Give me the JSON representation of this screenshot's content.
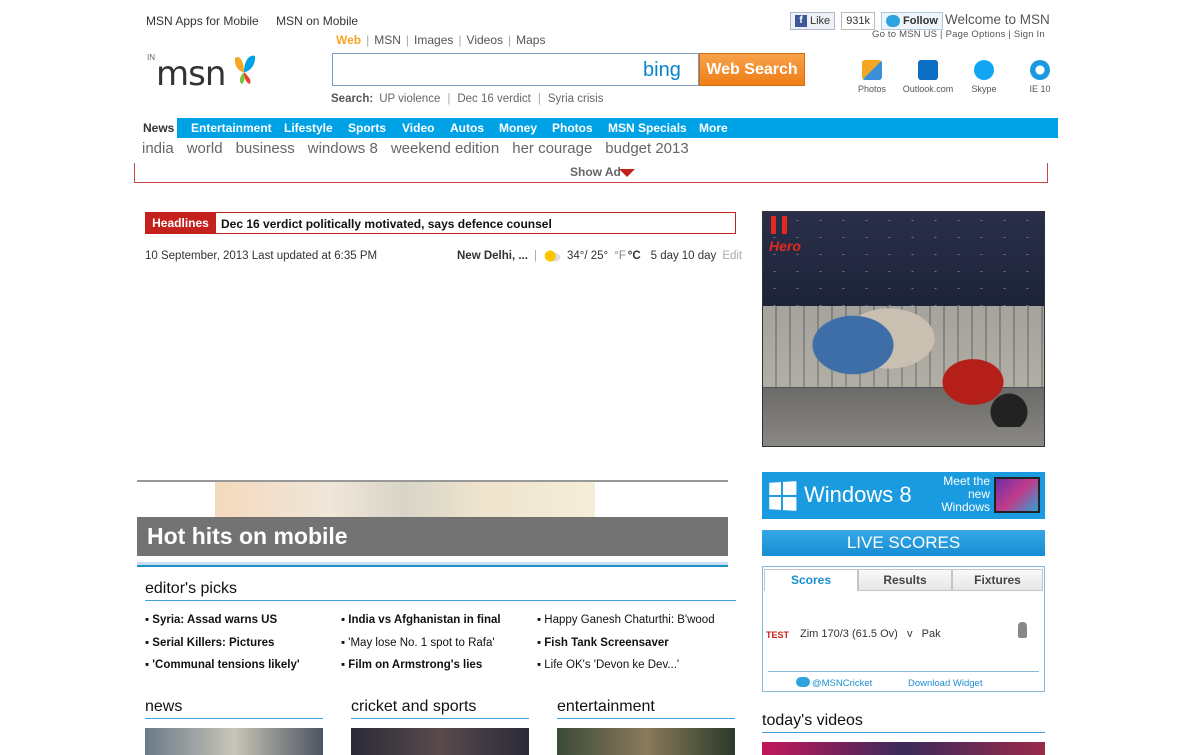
{
  "top_links": [
    "MSN Apps for Mobile",
    "MSN on Mobile"
  ],
  "social": {
    "like": "Like",
    "like_count": "931k",
    "follow": "Follow"
  },
  "welcome": "Welcome to MSN",
  "user_links": "Go to MSN US | Page Options | Sign In",
  "logo": {
    "region": "IN",
    "text": "msn"
  },
  "search": {
    "tabs": [
      "Web",
      "MSN",
      "Images",
      "Videos",
      "Maps"
    ],
    "active_tab": "Web",
    "bing": "bing",
    "button": "Web Search",
    "trending_label": "Search:",
    "trending": [
      "UP violence",
      "Dec 16 verdict",
      "Syria crisis"
    ]
  },
  "apps": [
    {
      "label": "Photos",
      "color": "#3a8fd6"
    },
    {
      "label": "Outlook.com",
      "color": "#0a6fc2"
    },
    {
      "label": "Skype",
      "color": "#12a5f4"
    },
    {
      "label": "IE 10",
      "color": "#1a9be0"
    }
  ],
  "nav": {
    "active": "News",
    "items": [
      "Entertainment",
      "Lifestyle",
      "Sports",
      "Video",
      "Autos",
      "Money",
      "Photos",
      "MSN Specials",
      "More"
    ]
  },
  "sublinks": [
    "india",
    "world",
    "business",
    "windows 8",
    "weekend edition",
    "her courage",
    "budget 2013"
  ],
  "show_ad": "Show Ad",
  "headline": {
    "label": "Headlines",
    "text": "Dec 16 verdict politically motivated, says defence counsel"
  },
  "dateline": "10 September, 2013  Last updated at 6:35 PM",
  "weather": {
    "city": "New Delhi, ...",
    "temps": "34°/ 25°",
    "unit_f": "°F",
    "unit_c": "°C",
    "forecast5": "5 day",
    "forecast10": "10 day",
    "edit": "Edit"
  },
  "hot_hits": "Hot hits on mobile",
  "editors_picks": {
    "title": "editor's picks",
    "items": [
      {
        "text": "Syria: Assad warns US",
        "bold": true
      },
      {
        "text": "India vs Afghanistan in final",
        "bold": true
      },
      {
        "text": "Happy Ganesh Chaturthi: B'wood",
        "bold": false
      },
      {
        "text": "Serial Killers: Pictures",
        "bold": true
      },
      {
        "text": "'May lose No. 1 spot to Rafa'",
        "bold": false
      },
      {
        "text": "Fish Tank Screensaver",
        "bold": true
      },
      {
        "text": "'Communal tensions likely'",
        "bold": true
      },
      {
        "text": "Film on Armstrong's lies",
        "bold": true
      },
      {
        "text": "Life OK's 'Devon ke Dev...'",
        "bold": false
      }
    ]
  },
  "sections": [
    "news",
    "cricket and sports",
    "entertainment"
  ],
  "ad": {
    "brand": "Hero"
  },
  "win8": {
    "name": "Windows 8",
    "tagline": "Meet the new Windows"
  },
  "live_scores": {
    "title": "LIVE SCORES",
    "tabs": [
      "Scores",
      "Results",
      "Fixtures"
    ],
    "active_tab": "Scores",
    "match_type": "TEST",
    "match": "Zim 170/3 (61.5 Ov)   v   Pak",
    "twitter": "@MSNCricket",
    "download": "Download Widget"
  },
  "todays_videos": "today's videos"
}
